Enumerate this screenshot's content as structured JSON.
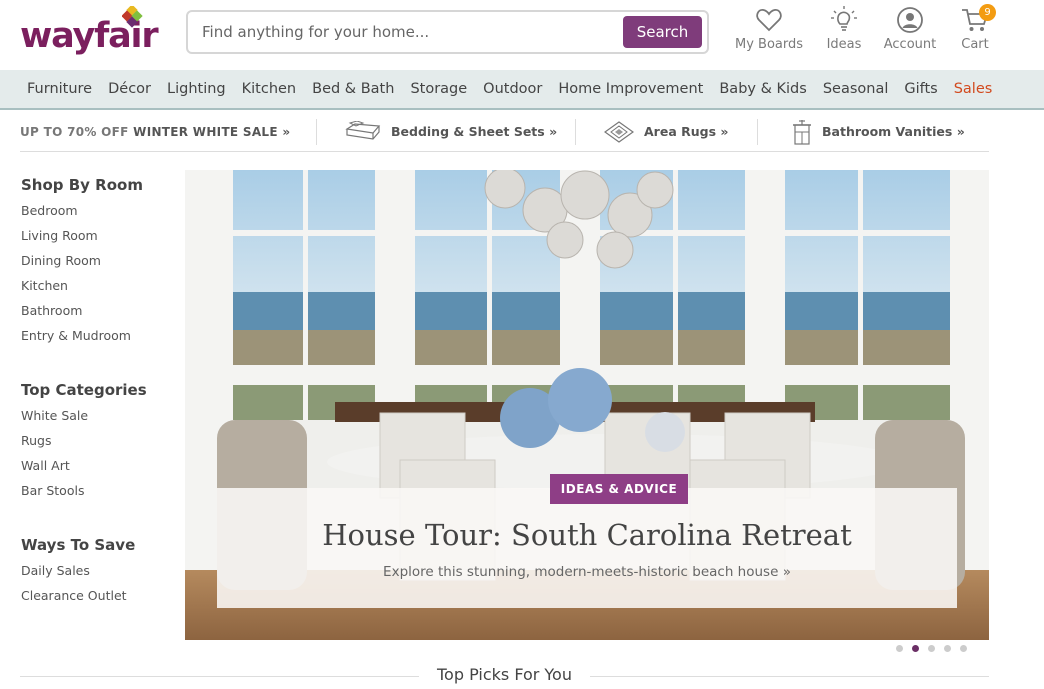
{
  "brand": {
    "name": "wayfair",
    "mark_colors": [
      "#e8b921",
      "#c0392b",
      "#7fbf3f",
      "#6a2c70"
    ]
  },
  "search": {
    "placeholder": "Find anything for your home...",
    "button_label": "Search"
  },
  "header_nav": [
    {
      "label": "My Boards",
      "icon": "heart-icon"
    },
    {
      "label": "Ideas",
      "icon": "lightbulb-icon"
    },
    {
      "label": "Account",
      "icon": "user-icon"
    },
    {
      "label": "Cart",
      "icon": "cart-icon",
      "badge": "9"
    }
  ],
  "categories": [
    "Furniture",
    "Décor",
    "Lighting",
    "Kitchen",
    "Bed & Bath",
    "Storage",
    "Outdoor",
    "Home Improvement",
    "Baby & Kids",
    "Seasonal",
    "Gifts",
    "Sales"
  ],
  "promo": {
    "sale_prefix": "UP TO 70% OFF ",
    "sale_label": "WINTER WHITE SALE »",
    "items": [
      {
        "label": "Bedding & Sheet Sets »",
        "icon": "bedding-icon"
      },
      {
        "label": "Area Rugs »",
        "icon": "rug-icon"
      },
      {
        "label": "Bathroom Vanities »",
        "icon": "vanity-icon"
      }
    ]
  },
  "sidebar": {
    "shop_by_room": {
      "title": "Shop By Room",
      "items": [
        "Bedroom",
        "Living Room",
        "Dining Room",
        "Kitchen",
        "Bathroom",
        "Entry & Mudroom"
      ]
    },
    "top_categories": {
      "title": "Top Categories",
      "items": [
        "White Sale",
        "Rugs",
        "Wall Art",
        "Bar Stools"
      ]
    },
    "ways_to_save": {
      "title": "Ways To Save",
      "items": [
        "Daily Sales",
        "Clearance Outlet"
      ]
    }
  },
  "hero": {
    "badge": "IDEAS & ADVICE",
    "title": "House Tour: South Carolina Retreat",
    "subtitle": "Explore this stunning, modern-meets-historic beach house »",
    "slide_count": 5,
    "active_slide": 2
  },
  "section_title": "Top Picks For You",
  "colors": {
    "brand_purple": "#7b1f5e",
    "button_purple": "#7f3c7b",
    "sales_orange": "#d24a1e",
    "nav_bg": "#e4ebeb",
    "badge_orange": "#f39c12"
  }
}
